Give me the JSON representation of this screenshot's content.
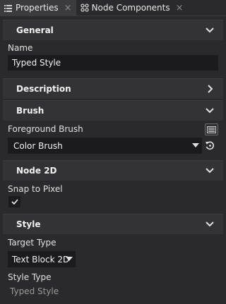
{
  "tabs": [
    {
      "label": "Properties",
      "icon": "list-icon",
      "active": true
    },
    {
      "label": "Node Components",
      "icon": "components-icon",
      "active": false
    }
  ],
  "tab_close_glyph": "×",
  "sections": {
    "general": {
      "title": "General",
      "expanded": true
    },
    "description": {
      "title": "Description",
      "expanded": false
    },
    "brush": {
      "title": "Brush",
      "expanded": true
    },
    "node2d": {
      "title": "Node 2D",
      "expanded": true
    },
    "style": {
      "title": "Style",
      "expanded": true
    }
  },
  "general": {
    "name_label": "Name",
    "name_value": "Typed Style"
  },
  "brush": {
    "foreground_label": "Foreground Brush",
    "foreground_value": "Color Brush"
  },
  "node2d": {
    "snap_label": "Snap to Pixel",
    "snap_checked": true
  },
  "style": {
    "target_type_label": "Target Type",
    "target_type_value": "Text Block 2D",
    "style_type_label": "Style Type",
    "style_type_value": "Typed Style"
  },
  "colors": {
    "background": "#2a2a2c",
    "header": "#333336",
    "field": "#1b1b1d",
    "text": "#e6e6e6",
    "muted": "#9a9a9a"
  }
}
